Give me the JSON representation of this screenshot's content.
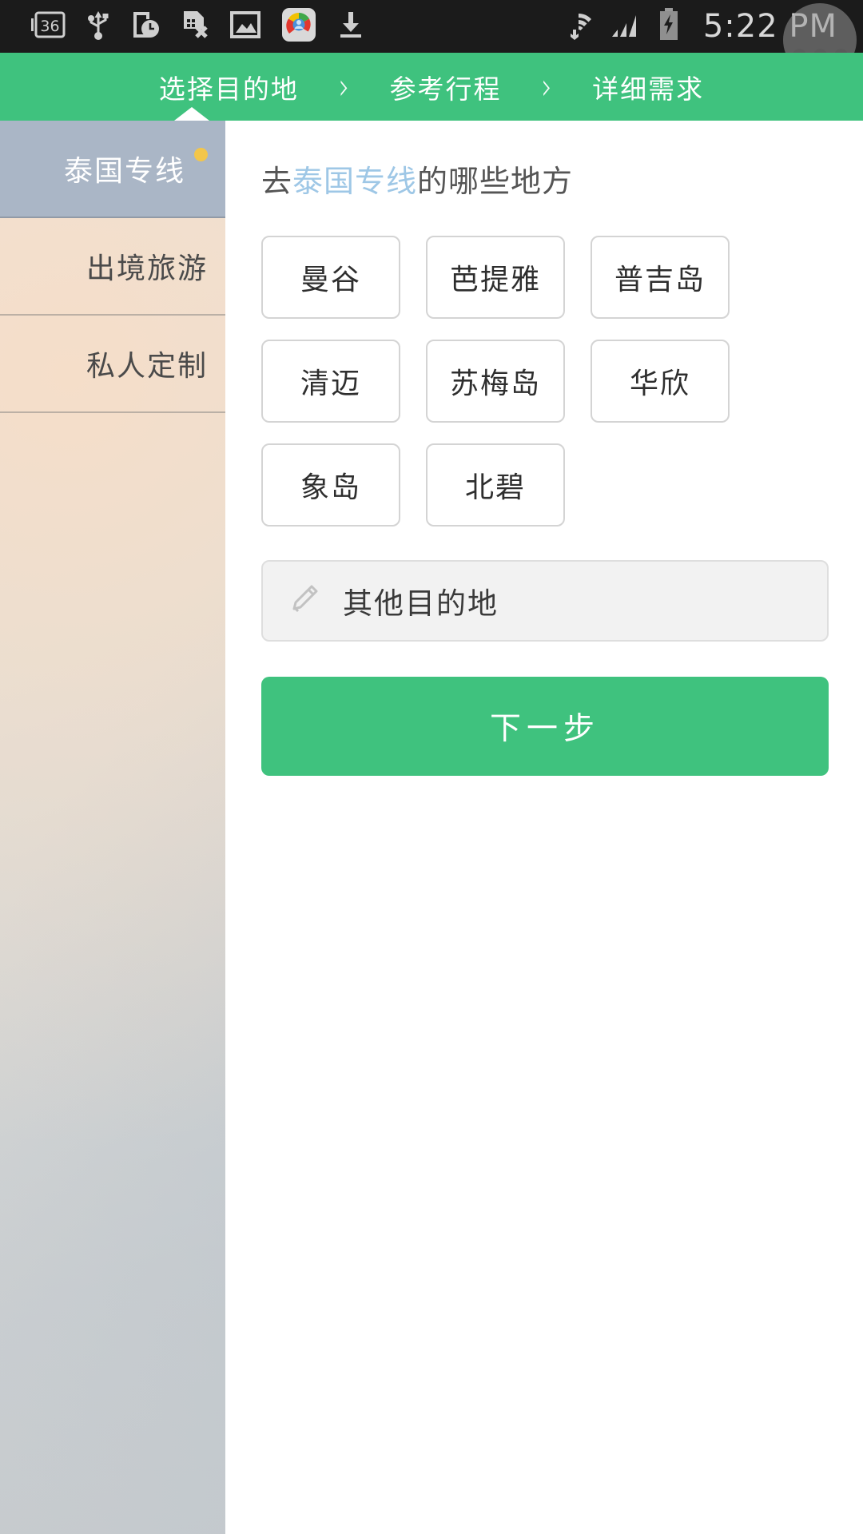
{
  "status_bar": {
    "battery_badge": "36",
    "time": "5:22 PM",
    "left_icons": [
      "battery-36-icon",
      "usb-icon",
      "device-clock-icon",
      "sim-card-error-icon",
      "photo-icon",
      "browser-app-icon",
      "download-icon"
    ],
    "right_icons": [
      "wifi-icon",
      "cellular-signal-icon",
      "battery-charging-icon"
    ],
    "touch_indicator": "recent-apps-touch-overlay"
  },
  "steps": {
    "items": [
      {
        "label": "选择目的地",
        "active": true
      },
      {
        "label": "参考行程",
        "active": false
      },
      {
        "label": "详细需求",
        "active": false
      }
    ],
    "separator": "›"
  },
  "sidebar": {
    "items": [
      {
        "label": "泰国专线",
        "active": true,
        "badge": true
      },
      {
        "label": "出境旅游",
        "active": false,
        "badge": false
      },
      {
        "label": "私人定制",
        "active": false,
        "badge": false
      }
    ]
  },
  "main": {
    "question_prefix": "去",
    "question_highlight": "泰国专线",
    "question_suffix": "的哪些地方",
    "destinations": [
      "曼谷",
      "芭提雅",
      "普吉岛",
      "清迈",
      "苏梅岛",
      "华欣",
      "象岛",
      "北碧"
    ],
    "other_field": {
      "label": "其他目的地",
      "icon": "pencil-icon"
    },
    "next_button": "下一步"
  },
  "colors": {
    "brand_green": "#3fc27e",
    "active_sidebar": "#aab6c6",
    "badge_orange": "#f3c64a",
    "highlight_blue": "#9ec7e6",
    "status_bar_bg": "#1b1b1b"
  }
}
